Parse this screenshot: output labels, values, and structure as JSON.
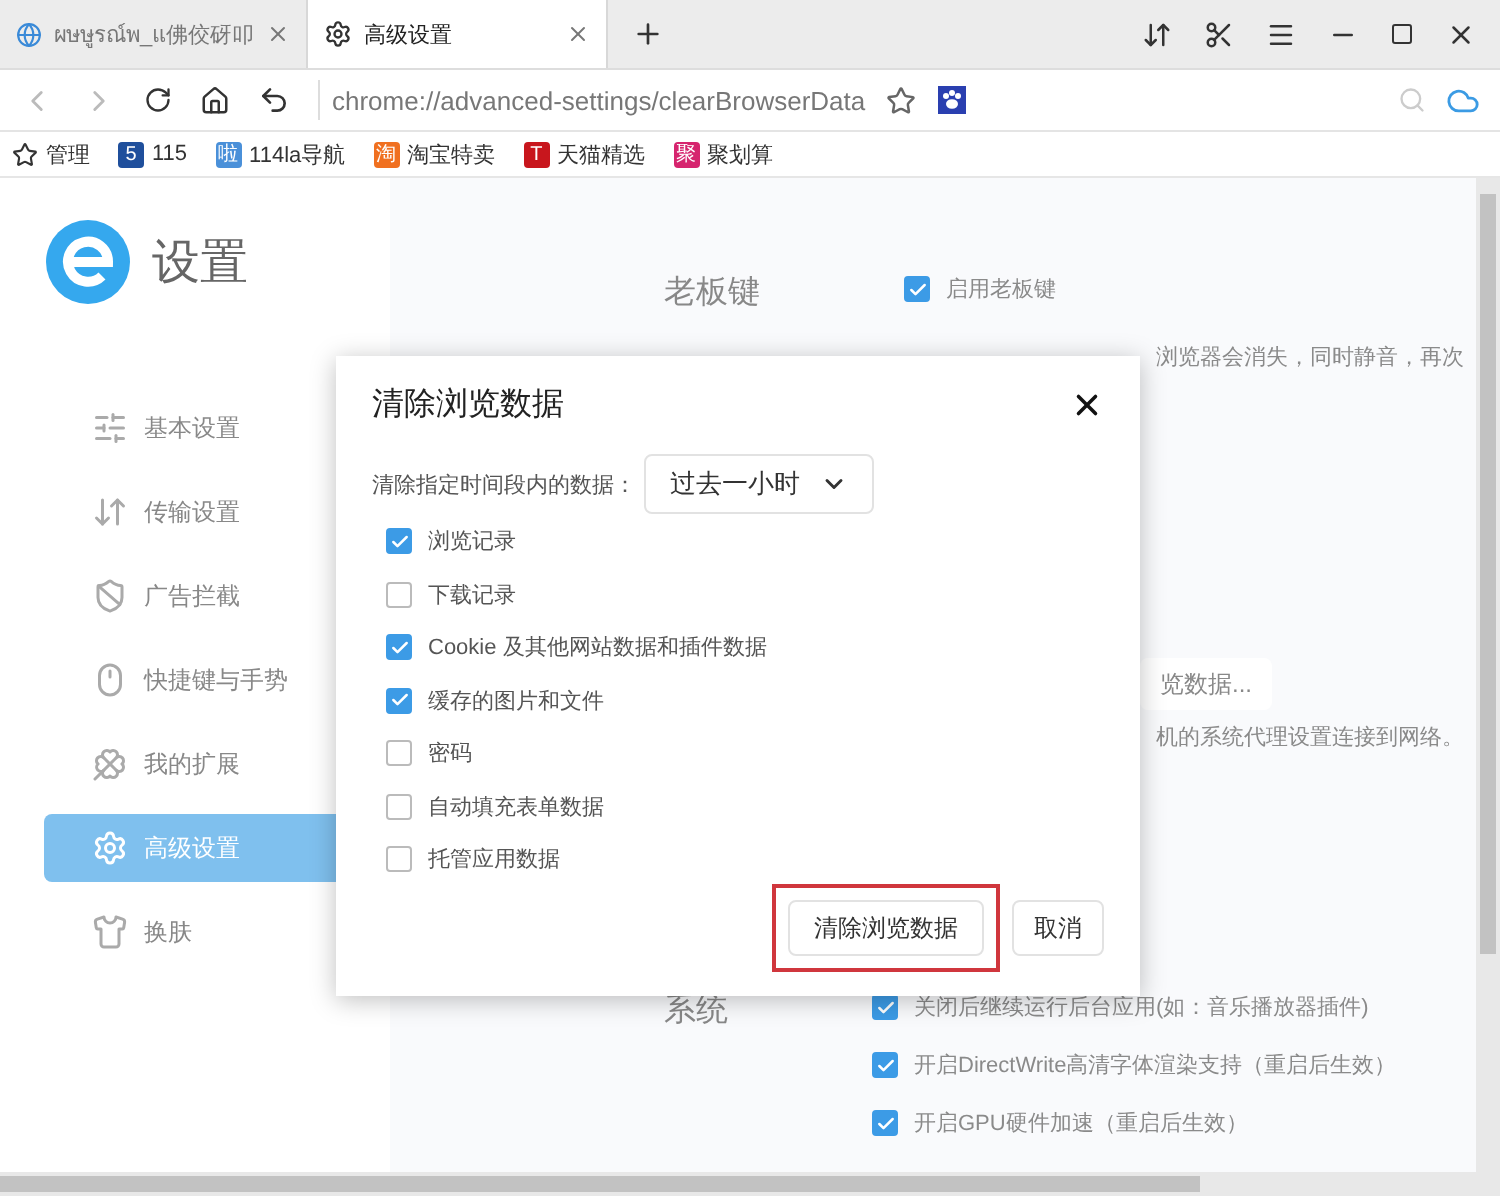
{
  "tabs": [
    {
      "title": "ผษษูรณ์พ_แ佛佼砑叩",
      "selected": false
    },
    {
      "title": "高级设置",
      "selected": true
    }
  ],
  "address": "chrome://advanced-settings/clearBrowserData",
  "bookmarks": [
    {
      "label": "管理"
    },
    {
      "label": "115",
      "badge": "5",
      "color": "#1f4f9c"
    },
    {
      "label": "114la导航",
      "badge": "啦",
      "color": "#4a90d9"
    },
    {
      "label": "淘宝特卖",
      "badge": "淘",
      "color": "#f07020"
    },
    {
      "label": "天猫精选",
      "badge": "T",
      "color": "#c8161d"
    },
    {
      "label": "聚划算",
      "badge": "聚",
      "color": "#d6246e"
    }
  ],
  "sidebar": {
    "title": "设置",
    "items": [
      {
        "label": "基本设置",
        "selected": false
      },
      {
        "label": "传输设置",
        "selected": false
      },
      {
        "label": "广告拦截",
        "selected": false
      },
      {
        "label": "快捷键与手势",
        "selected": false
      },
      {
        "label": "我的扩展",
        "selected": false
      },
      {
        "label": "高级设置",
        "selected": true
      },
      {
        "label": "换肤",
        "selected": false
      }
    ]
  },
  "background": {
    "boss_heading": "老板键",
    "boss_option": {
      "label": "启用老板键",
      "checked": true
    },
    "boss_hint": "浏览器会消失，同时静音，再次",
    "clear_button": "览数据...",
    "proxy_hint": "机的系统代理设置连接到网络。",
    "system_heading": "系统",
    "system_options": [
      {
        "label": "关闭后继续运行后台应用(如：音乐播放器插件)",
        "checked": true
      },
      {
        "label": "开启DirectWrite高清字体渲染支持（重启后生效）",
        "checked": true
      },
      {
        "label": "开启GPU硬件加速（重启后生效）",
        "checked": true
      }
    ]
  },
  "dialog": {
    "title": "清除浏览数据",
    "range_label": "清除指定时间段内的数据：",
    "range_value": "过去一小时",
    "options": [
      {
        "label": "浏览记录",
        "checked": true
      },
      {
        "label": "下载记录",
        "checked": false
      },
      {
        "label": "Cookie 及其他网站数据和插件数据",
        "checked": true
      },
      {
        "label": "缓存的图片和文件",
        "checked": true
      },
      {
        "label": "密码",
        "checked": false
      },
      {
        "label": "自动填充表单数据",
        "checked": false
      },
      {
        "label": "托管应用数据",
        "checked": false
      }
    ],
    "buttons": [
      {
        "label": "清除浏览数据",
        "kind": "primary",
        "highlighted": true
      },
      {
        "label": "取消",
        "kind": "cancel",
        "highlighted": false
      }
    ]
  }
}
